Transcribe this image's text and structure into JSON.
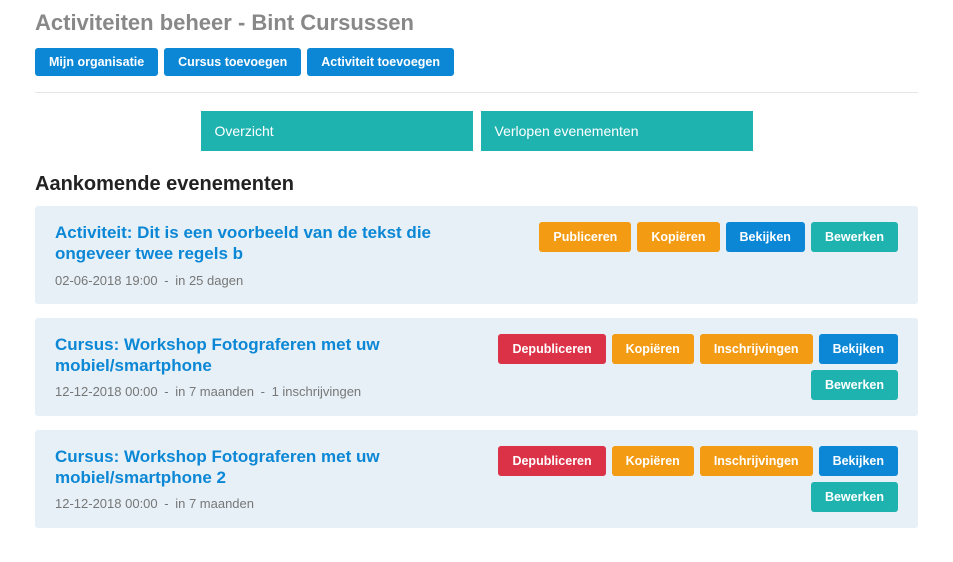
{
  "page_title": "Activiteiten beheer - Bint Cursussen",
  "top_buttons": {
    "my_org": "Mijn organisatie",
    "add_course": "Cursus toevoegen",
    "add_activity": "Activiteit toevoegen"
  },
  "tabs": {
    "overview": "Overzicht",
    "expired": "Verlopen evenementen"
  },
  "section_title": "Aankomende evenementen",
  "events": [
    {
      "title": "Activiteit: Dit is een voorbeeld van de tekst die ongeveer twee regels b",
      "date": "02-06-2018 19:00",
      "relative": "in 25 dagen",
      "extra": "",
      "buttons": [
        {
          "label": "Publiceren",
          "cls": "btn-orange"
        },
        {
          "label": "Kopiëren",
          "cls": "btn-orange"
        },
        {
          "label": "Bekijken",
          "cls": "btn-blue"
        },
        {
          "label": "Bewerken",
          "cls": "btn-teal"
        }
      ]
    },
    {
      "title": "Cursus: Workshop Fotograferen met uw mobiel/smartphone",
      "date": "12-12-2018 00:00",
      "relative": "in 7 maanden",
      "extra": "1 inschrijvingen",
      "buttons": [
        {
          "label": "Depubliceren",
          "cls": "btn-red"
        },
        {
          "label": "Kopiëren",
          "cls": "btn-orange"
        },
        {
          "label": "Inschrijvingen",
          "cls": "btn-orange"
        },
        {
          "label": "Bekijken",
          "cls": "btn-blue"
        },
        {
          "label": "Bewerken",
          "cls": "btn-teal"
        }
      ]
    },
    {
      "title": "Cursus: Workshop Fotograferen met uw mobiel/smartphone 2",
      "date": "12-12-2018 00:00",
      "relative": "in 7 maanden",
      "extra": "",
      "buttons": [
        {
          "label": "Depubliceren",
          "cls": "btn-red"
        },
        {
          "label": "Kopiëren",
          "cls": "btn-orange"
        },
        {
          "label": "Inschrijvingen",
          "cls": "btn-orange"
        },
        {
          "label": "Bekijken",
          "cls": "btn-blue"
        },
        {
          "label": "Bewerken",
          "cls": "btn-teal"
        }
      ]
    }
  ]
}
